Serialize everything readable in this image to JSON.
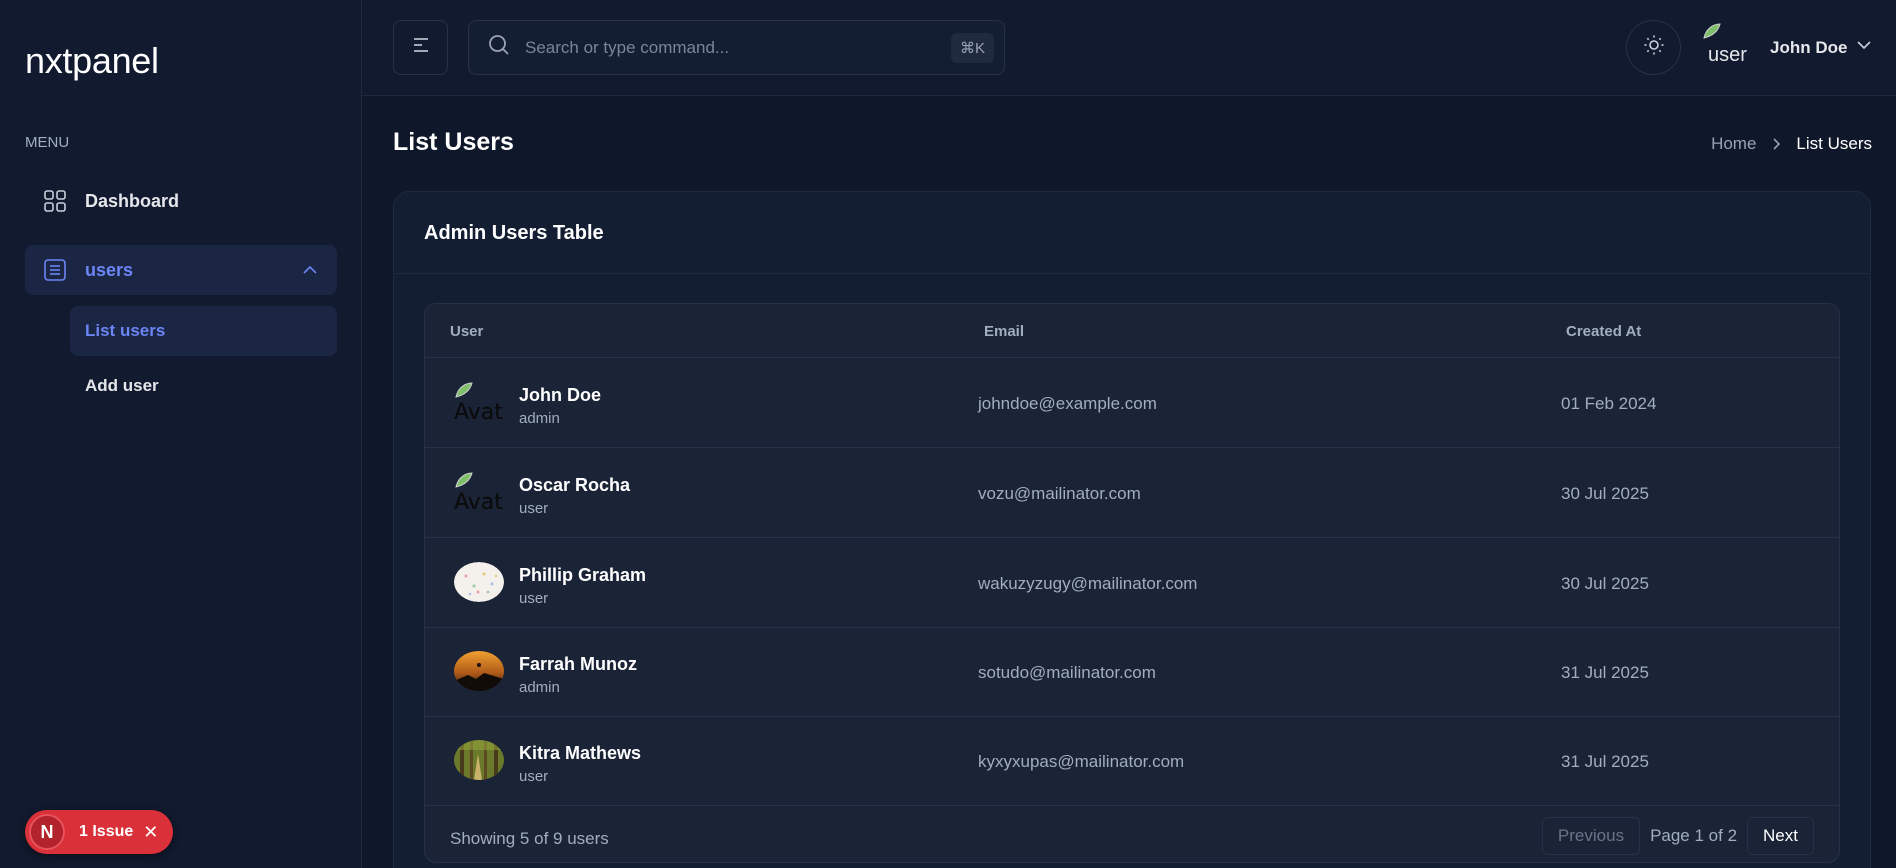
{
  "sidebar": {
    "brand": "nxtpanel",
    "menu_label": "MENU",
    "items": [
      {
        "label": "Dashboard",
        "icon": "grid-icon"
      },
      {
        "label": "users",
        "icon": "document-icon",
        "expanded": true
      }
    ],
    "sub_items": [
      {
        "label": "List users",
        "active": true
      },
      {
        "label": "Add user",
        "active": false
      }
    ]
  },
  "issue_badge": {
    "letter": "N",
    "text": "1 Issue"
  },
  "header": {
    "search_placeholder": "Search or type command...",
    "shortcut": "⌘K",
    "avatar_alt": "user",
    "user_name": "John Doe"
  },
  "page": {
    "title": "List Users",
    "breadcrumb": {
      "home": "Home",
      "current": "List Users"
    }
  },
  "card": {
    "title": "Admin Users Table",
    "columns": [
      "User",
      "Email",
      "Created At"
    ],
    "rows": [
      {
        "name": "John Doe",
        "role": "admin",
        "email": "johndoe@example.com",
        "created": "01 Feb 2024",
        "avatar": "broken",
        "avatar_alt": "Avatar"
      },
      {
        "name": "Oscar Rocha",
        "role": "user",
        "email": "vozu@mailinator.com",
        "created": "30 Jul 2025",
        "avatar": "broken",
        "avatar_alt": "Avatar"
      },
      {
        "name": "Phillip Graham",
        "role": "user",
        "email": "wakuzyzugy@mailinator.com",
        "created": "30 Jul 2025",
        "avatar": "confetti"
      },
      {
        "name": "Farrah Munoz",
        "role": "admin",
        "email": "sotudo@mailinator.com",
        "created": "31 Jul 2025",
        "avatar": "sunset"
      },
      {
        "name": "Kitra Mathews",
        "role": "user",
        "email": "kyxyxupas@mailinator.com",
        "created": "31 Jul 2025",
        "avatar": "forest"
      }
    ],
    "showing": "Showing 5 of 9 users",
    "pagination": {
      "previous": "Previous",
      "page_info": "Page 1 of 2",
      "next": "Next"
    }
  },
  "colors": {
    "background": "#0f172a",
    "sidebar": "#111a2e",
    "accent": "#6b85f5",
    "issue_red": "#d9303a"
  }
}
